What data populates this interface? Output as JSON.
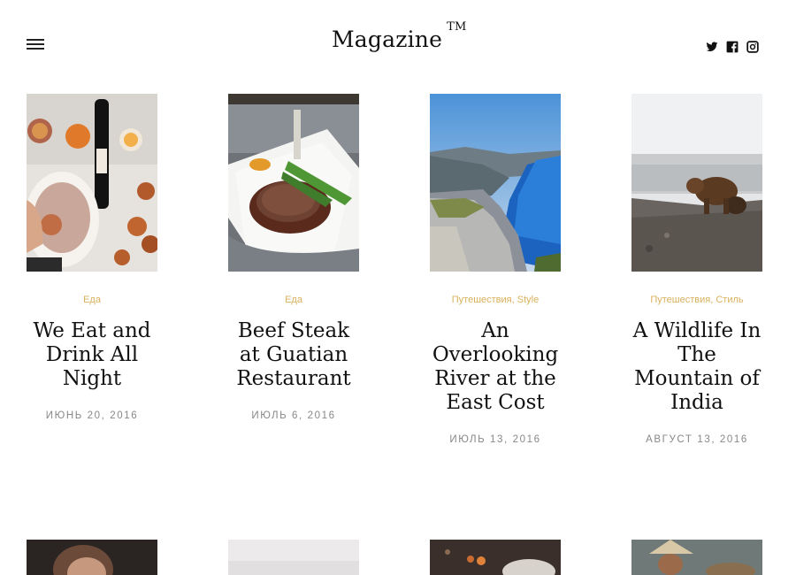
{
  "header": {
    "logo_text": "Magazine",
    "logo_mark": "TM",
    "menu_icon": "hamburger-menu-icon",
    "social": [
      "twitter-icon",
      "facebook-icon",
      "instagram-icon"
    ]
  },
  "colors": {
    "accent": "#d9b15c",
    "date": "#888888",
    "title": "#111111"
  },
  "posts": [
    {
      "categories": [
        "Еда"
      ],
      "title": "We Eat and Drink All Night",
      "date": "ИЮНЬ 20, 2016"
    },
    {
      "categories": [
        "Еда"
      ],
      "title": "Beef Steak at Guatian Restaurant",
      "date": "ИЮЛЬ 6, 2016"
    },
    {
      "categories": [
        "Путешествия",
        "Style"
      ],
      "title": "An Overlooking River at the East Cost",
      "date": "ИЮЛЬ 13, 2016"
    },
    {
      "categories": [
        "Путешествия",
        "Стиль"
      ],
      "title": "A Wildlife In The Mountain of India",
      "date": "АВГУСТ 13, 2016"
    }
  ],
  "separator": ","
}
